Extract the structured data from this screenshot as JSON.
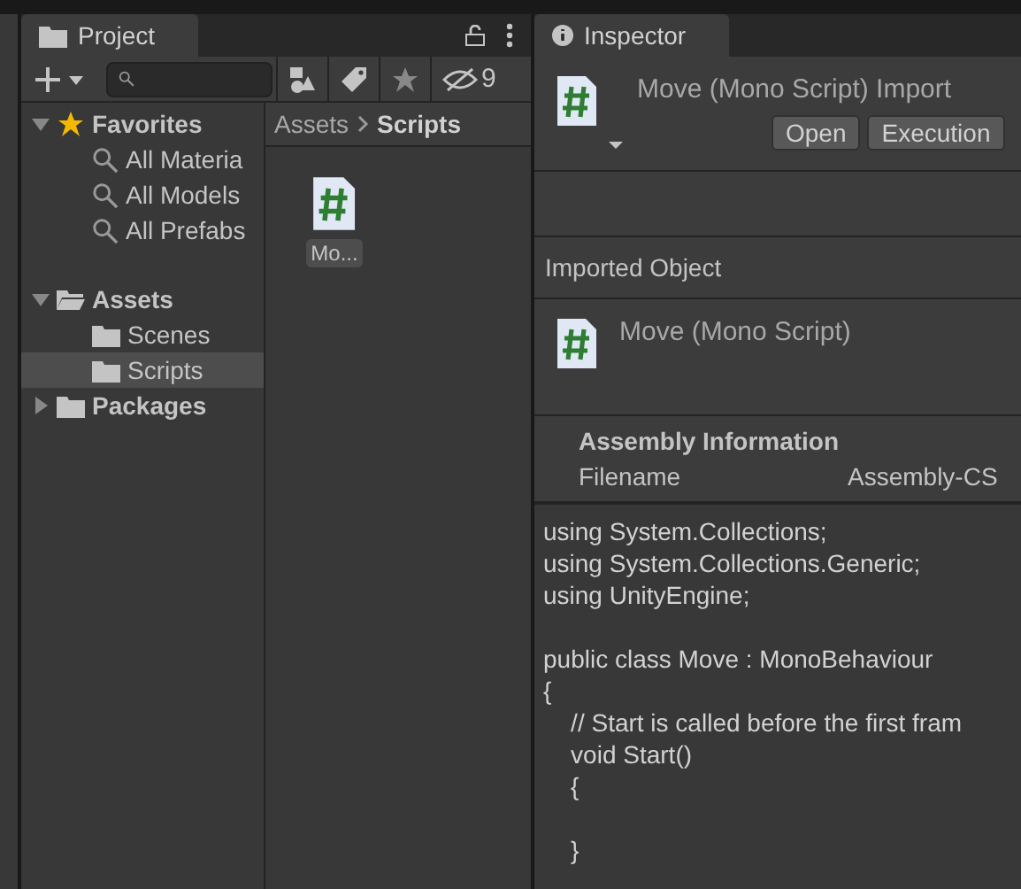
{
  "project": {
    "tab": {
      "label": "Project",
      "selected": true
    },
    "toolbar": {
      "hidden_count": "9"
    },
    "tree": [
      {
        "label": "Favorites",
        "kind": "favorites",
        "expanded": true,
        "selected": false,
        "children": [
          {
            "label": "All Materia",
            "kind": "search",
            "selected": false
          },
          {
            "label": "All Models",
            "kind": "search",
            "selected": false
          },
          {
            "label": "All Prefabs",
            "kind": "search",
            "selected": false
          }
        ]
      },
      {
        "label": "Assets",
        "kind": "folder",
        "expanded": true,
        "selected": false,
        "children": [
          {
            "label": "Scenes",
            "kind": "folder",
            "selected": false
          },
          {
            "label": "Scripts",
            "kind": "folder",
            "selected": true
          }
        ]
      },
      {
        "label": "Packages",
        "kind": "folder",
        "expanded": false,
        "selected": false
      }
    ],
    "breadcrumb": [
      "Assets",
      "Scripts"
    ],
    "files": [
      {
        "label": "Mo...",
        "kind": "script"
      }
    ]
  },
  "inspector": {
    "tab": {
      "label": "Inspector",
      "selected": true
    },
    "title": "Move (Mono Script) Import",
    "buttons": [
      "Open",
      "Execution"
    ],
    "imported_object": {
      "heading": "Imported Object",
      "name": "Move (Mono Script)"
    },
    "assembly": {
      "heading": "Assembly Information",
      "fields": [
        {
          "label": "Filename",
          "value": "Assembly-CS"
        }
      ]
    },
    "code": "using System.Collections;\nusing System.Collections.Generic;\nusing UnityEngine;\n\npublic class Move : MonoBehaviour\n{\n    // Start is called before the first fram\n    void Start()\n    {\n\n    }"
  }
}
